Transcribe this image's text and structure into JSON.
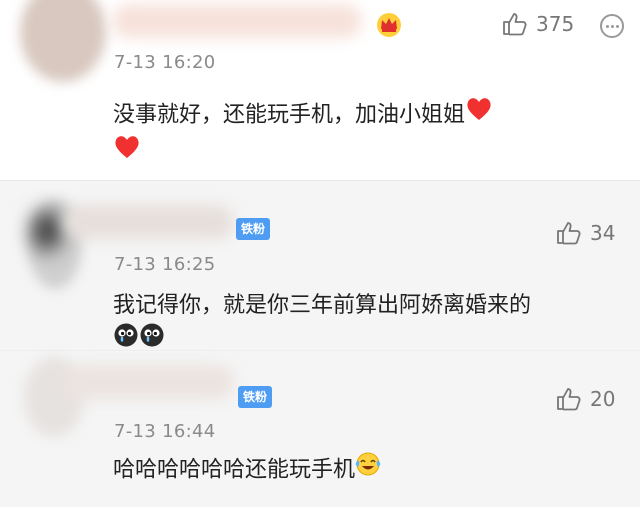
{
  "comments": [
    {
      "time": "7-13 16:20",
      "text": "没事就好，还能玩手机，加油小姐姐",
      "likes": "375",
      "icons": [
        "crown-icon",
        "red-heart-icon",
        "red-heart-icon",
        "like-icon",
        "more-icon"
      ]
    },
    {
      "badge": "铁粉",
      "time": "7-13 16:25",
      "text": "我记得你，就是你三年前算出阿娇离婚来的",
      "likes": "34",
      "icons": [
        "crying-face-icon",
        "crying-face-icon",
        "like-icon"
      ]
    },
    {
      "badge": "铁粉",
      "time": "7-13 16:44",
      "text": "哈哈哈哈哈哈还能玩手机",
      "likes": "20",
      "icons": [
        "laughing-tears-icon",
        "like-icon"
      ]
    }
  ],
  "colors": {
    "heart": "#f0312f",
    "badge": "#4e9df3",
    "crown": "#f5a300"
  }
}
